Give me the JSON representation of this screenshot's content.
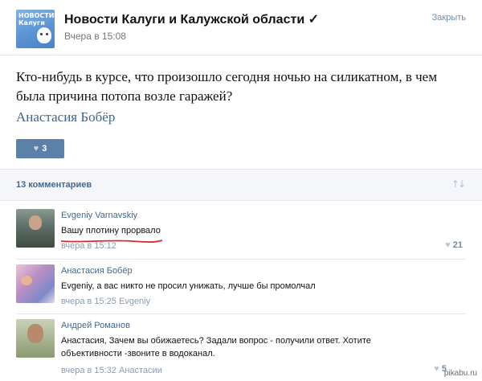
{
  "header": {
    "group_avatar_label_line1": "НОВОСТИ",
    "group_avatar_label_line2": "Калуги",
    "group_name": "Новости Калуги и Калужской области ✓",
    "post_time": "Вчера в 15:08",
    "close_label": "Закрыть"
  },
  "post": {
    "text": "Кто-нибудь в курсе, что произошло сегодня ночью на силикатном, в чем была причина потопа возле гаражей?",
    "author": "Анастасия Бобёр",
    "like_icon": "heart-icon",
    "likes": "3"
  },
  "comments_bar": {
    "count_label": "13 комментариев",
    "sort_icon": "sort-arrows-icon"
  },
  "comments": [
    {
      "author": "Evgeniy Varnavskiy",
      "text": "Вашу плотину прорвало",
      "time": "вчера в 15:12",
      "reply_to": "",
      "likes": "21",
      "highlight_color": "#d92b2b"
    },
    {
      "author": "Анастасия Бобёр",
      "text": "Evgeniy, а вас никто не просил унижать, лучше бы промолчал",
      "time": "вчера в 15:25",
      "reply_to": "Evgeniy",
      "likes": ""
    },
    {
      "author": "Андрей Романов",
      "text": "Анастасия, Зачем вы обижаетесь? Задали вопрос - получили ответ. Хотите объективности -звоните в водоканал.",
      "time": "вчера в 15:32",
      "reply_to": "Анастасии",
      "likes": "5"
    }
  ],
  "watermark": "pikabu.ru",
  "colors": {
    "link": "#45688e",
    "button": "#5c81a8",
    "divider": "#e4e6ea",
    "bar_bg": "#f4f6f9"
  }
}
